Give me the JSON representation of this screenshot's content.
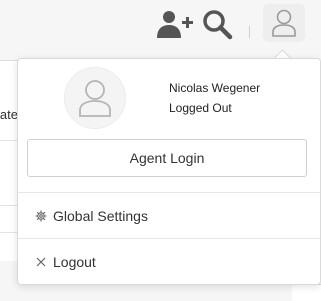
{
  "background": {
    "partial_text": "ate"
  },
  "user_menu": {
    "name": "Nicolas Wegener",
    "status": "Logged Out",
    "agent_login_label": "Agent Login",
    "items": [
      {
        "icon": "gear-icon",
        "label": "Global Settings"
      },
      {
        "icon": "close-icon",
        "label": "Logout"
      }
    ]
  },
  "colors": {
    "icon_dark": "#555555",
    "icon_light": "#9a9a9a"
  }
}
